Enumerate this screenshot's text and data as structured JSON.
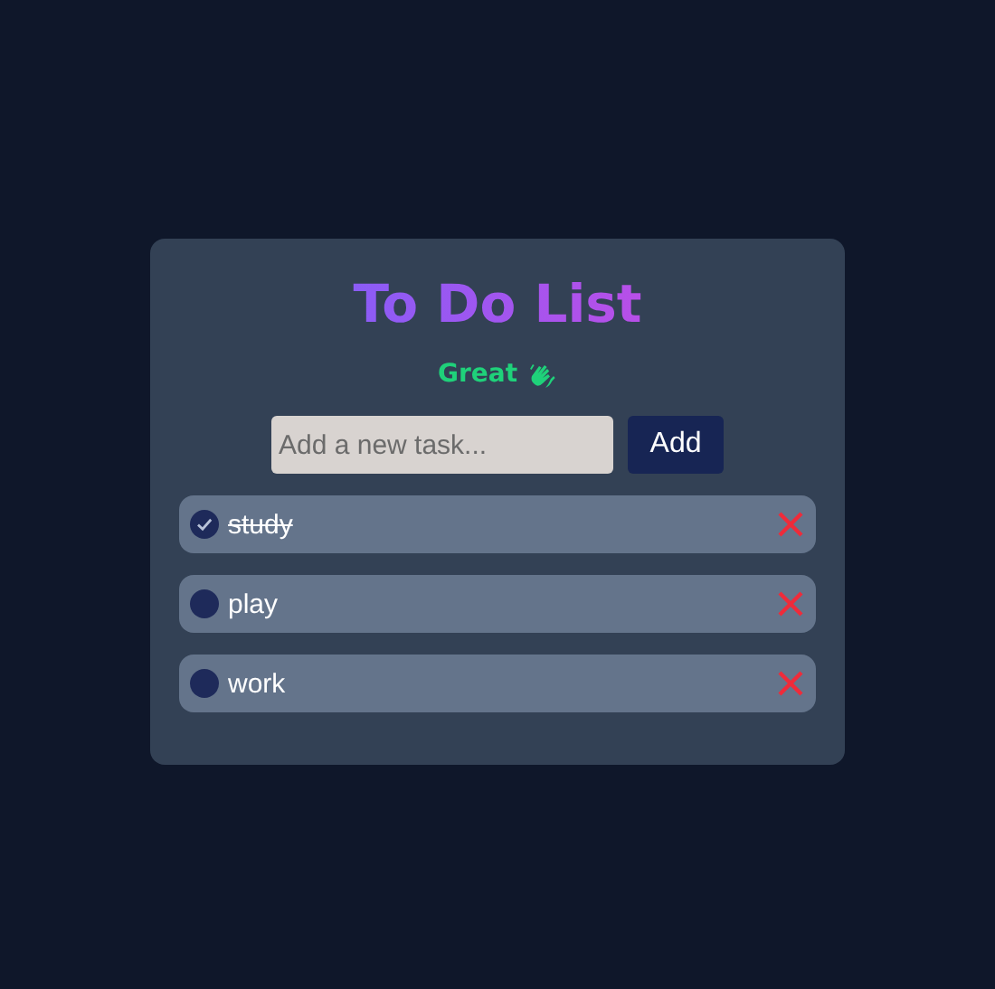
{
  "title": "To Do List",
  "message": "Great",
  "new_task": {
    "placeholder": "Add a new task..."
  },
  "add_button": "Add",
  "tasks": [
    {
      "label": "study",
      "checked": true
    },
    {
      "label": "play",
      "checked": false
    },
    {
      "label": "work",
      "checked": false
    }
  ]
}
